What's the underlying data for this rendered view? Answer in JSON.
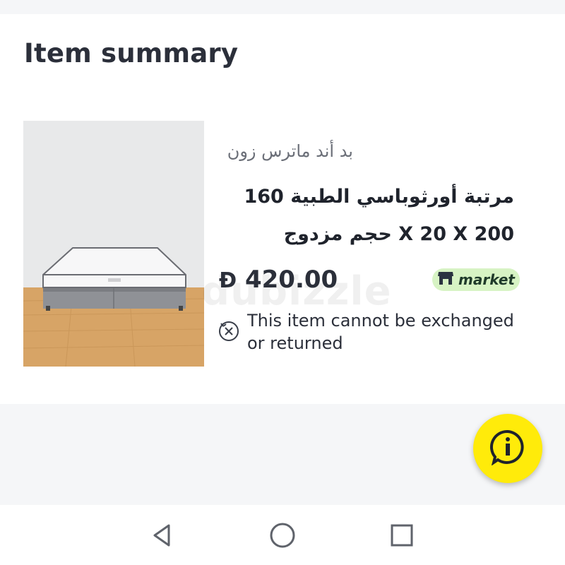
{
  "header": {
    "title": "Item summary"
  },
  "item": {
    "seller": "بد أند ماترس زون",
    "title": "مرتبة أورثوباسي الطبية 160 200 X 20 X حجم مزدوج",
    "price_currency": "Đ",
    "price_value": "420.00",
    "badge_label": "market",
    "policy_text": "This item cannot be exchanged or returned"
  },
  "watermark": "dubizzle",
  "colors": {
    "badge_bg": "#d7f3c4",
    "fab_bg": "#ffeb0a",
    "title": "#2b2f3a"
  },
  "icons": {
    "fab": "info-chat-icon",
    "policy": "no-return-icon",
    "badge": "store-icon",
    "nav_back": "back-triangle-icon",
    "nav_home": "home-circle-icon",
    "nav_recents": "recents-square-icon"
  }
}
